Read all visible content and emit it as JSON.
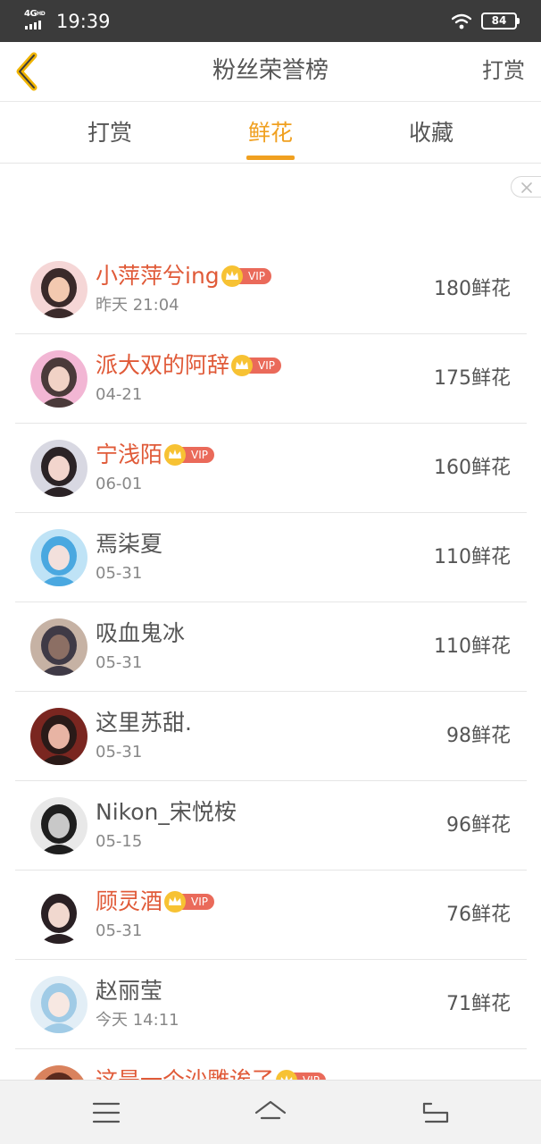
{
  "status_bar": {
    "network": "4G",
    "hd": "HD",
    "time": "19:39",
    "battery": "84",
    "icons": [
      "signal-icon",
      "wifi-icon",
      "battery-icon"
    ]
  },
  "header": {
    "back_icon": "chevron-left-icon",
    "title": "粉丝荣誉榜",
    "action_label": "打赏"
  },
  "tabs": [
    {
      "label": "打赏",
      "active": false
    },
    {
      "label": "鲜花",
      "active": true
    },
    {
      "label": "收藏",
      "active": false
    }
  ],
  "ad": {
    "close_icon": "close-icon"
  },
  "colors": {
    "accent": "#f0a020",
    "vip_name": "#e05a38",
    "vip_tag": "#ea6a5a",
    "crown": "#f7c233",
    "status_bar": "#3b3b3b"
  },
  "vip_label": "VIP",
  "fans": [
    {
      "name": "小萍萍兮ing",
      "vip": true,
      "time": "昨天 21:04",
      "count": "180鲜花"
    },
    {
      "name": "派大双的阿辞",
      "vip": true,
      "time": "04-21",
      "count": "175鲜花"
    },
    {
      "name": "宁浅陌",
      "vip": true,
      "time": "06-01",
      "count": "160鲜花"
    },
    {
      "name": "焉柒夏",
      "vip": false,
      "time": "05-31",
      "count": "110鲜花"
    },
    {
      "name": "吸血鬼冰",
      "vip": false,
      "time": "05-31",
      "count": "110鲜花"
    },
    {
      "name": "这里苏甜.",
      "vip": false,
      "time": "05-31",
      "count": "98鲜花"
    },
    {
      "name": "Nikon_宋悦桉",
      "vip": false,
      "time": "05-15",
      "count": "96鲜花"
    },
    {
      "name": "顾灵酒",
      "vip": true,
      "time": "05-31",
      "count": "76鲜花"
    },
    {
      "name": "赵丽莹",
      "vip": false,
      "time": "今天 14:11",
      "count": "71鲜花"
    },
    {
      "name": "这是一个沙雕诶了",
      "vip": true,
      "time": "",
      "count": ""
    }
  ],
  "nav_bar": {
    "icons": [
      "menu-icon",
      "home-icon",
      "back-icon"
    ]
  }
}
